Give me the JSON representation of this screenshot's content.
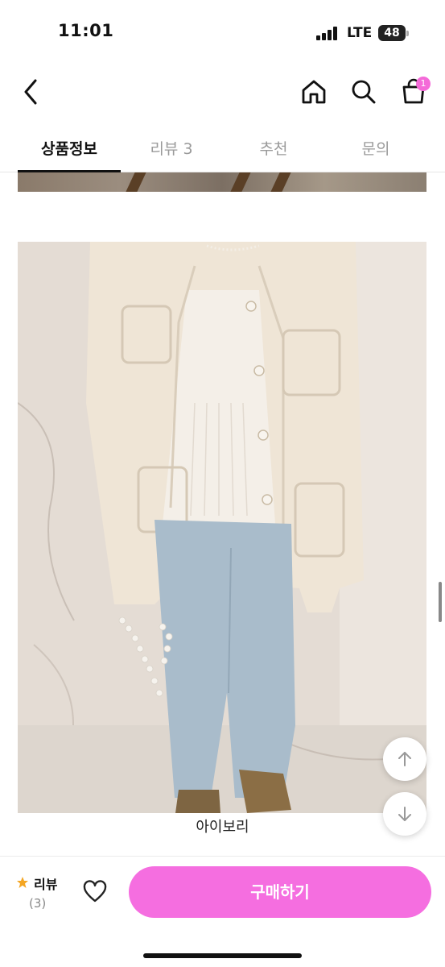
{
  "status_bar": {
    "time": "11:01",
    "network": "LTE",
    "battery": "48"
  },
  "nav": {
    "back_icon": "chevron-left-icon",
    "home_icon": "home-icon",
    "search_icon": "search-icon",
    "cart_icon": "shopping-bag-icon",
    "cart_badge": "1"
  },
  "tabs": [
    {
      "label": "상품정보",
      "active": true
    },
    {
      "label": "리뷰 3",
      "active": false
    },
    {
      "label": "추천",
      "active": false
    },
    {
      "label": "문의",
      "active": false
    }
  ],
  "product": {
    "image_caption": "아이보리"
  },
  "floating": {
    "up_icon": "arrow-up-icon",
    "down_icon": "arrow-down-icon"
  },
  "bottom_bar": {
    "review_label": "리뷰",
    "review_count": "(3)",
    "star_icon": "star-icon",
    "heart_icon": "heart-icon",
    "buy_label": "구매하기"
  },
  "colors": {
    "accent": "#f56ee0",
    "badge": "#f46ad8",
    "star": "#f4a623"
  }
}
